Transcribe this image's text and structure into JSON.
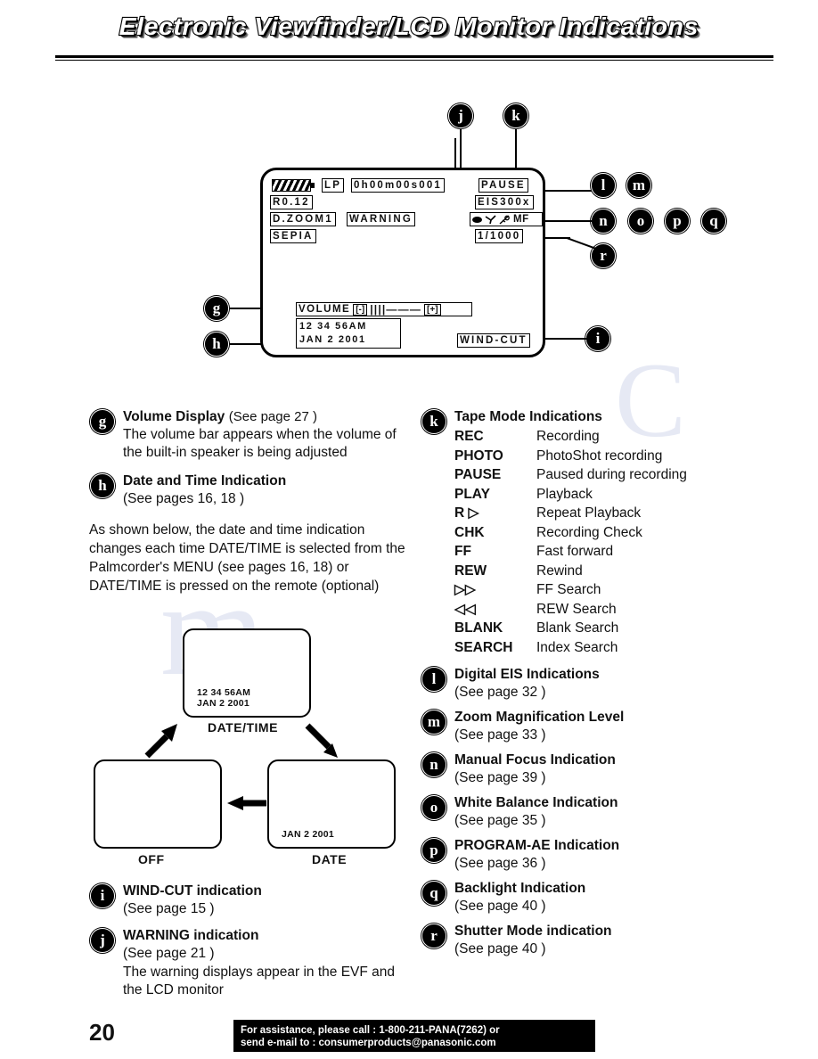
{
  "page": {
    "title": "Electronic Viewfinder/LCD Monitor Indications",
    "number": "20"
  },
  "lcd": {
    "battery_icon": "battery-icon",
    "tape_speed": "LP",
    "counter": "0h00m00s001",
    "tape_mode": "PAUSE",
    "remaining": "R0.12",
    "eis_zoom": "EIS300x",
    "digital_zoom": "D.ZOOM1",
    "warning": "WARNING",
    "focus": "MF",
    "effect": "SEPIA",
    "shutter": "1/1000",
    "volume_label": "VOLUME",
    "volume_minus": "[-]",
    "volume_ticks": "||||———",
    "volume_plus": "[+]",
    "time": "12 34 56AM",
    "date": "JAN  2 2001",
    "wind_cut": "WIND-CUT"
  },
  "callouts": {
    "g": "g",
    "h": "h",
    "i": "i",
    "j": "j",
    "k": "k",
    "l": "l",
    "m": "m",
    "n": "n",
    "o": "o",
    "p": "p",
    "q": "q",
    "r": "r"
  },
  "left_column": {
    "volume": {
      "badge": "g",
      "title": "Volume Display",
      "ref": "(See page 27 )",
      "body": "The volume bar appears when the volume of the built-in speaker is being adjusted"
    },
    "datetime": {
      "badge": "h",
      "title": "Date and Time Indication",
      "ref": "(See pages 16, 18 )"
    },
    "datetime_paragraph": "As shown below, the date and time indication changes each time DATE/TIME is selected from the Palmcorder's MENU (see pages 16, 18) or DATE/TIME is pressed on the remote (optional)",
    "windcut": {
      "badge": "i",
      "title": "WIND-CUT indication",
      "ref": "(See page 15 )"
    },
    "warning": {
      "badge": "j",
      "title": "WARNING indication",
      "ref": "(See page 21 )",
      "body": "The warning displays appear in the EVF and the LCD monitor"
    }
  },
  "flow_diagram": {
    "screens": [
      {
        "id": "datetime",
        "caption": "DATE/TIME",
        "line1": "12 34 56AM",
        "line2": "JAN 2 2001"
      },
      {
        "id": "date",
        "caption": "DATE",
        "line1": "JAN 2 2001",
        "line2": ""
      },
      {
        "id": "off",
        "caption": "OFF",
        "line1": "",
        "line2": ""
      }
    ]
  },
  "right_column": {
    "tape_mode": {
      "badge": "k",
      "title": "Tape Mode Indications",
      "rows": [
        {
          "code": "REC",
          "desc": "Recording"
        },
        {
          "code": "PHOTO",
          "desc": "PhotoShot recording"
        },
        {
          "code": "PAUSE",
          "desc": "Paused during recording"
        },
        {
          "code": "PLAY",
          "desc": "Playback"
        },
        {
          "code": "R ▷",
          "desc": "Repeat Playback"
        },
        {
          "code": "CHK",
          "desc": "Recording Check"
        },
        {
          "code": "FF",
          "desc": "Fast forward"
        },
        {
          "code": "REW",
          "desc": "Rewind"
        },
        {
          "code": "▷▷",
          "desc": "FF Search"
        },
        {
          "code": "◁◁",
          "desc": "REW Search"
        },
        {
          "code": "BLANK",
          "desc": "Blank Search"
        },
        {
          "code": "SEARCH",
          "desc": "Index Search"
        }
      ]
    },
    "items": [
      {
        "badge": "l",
        "title": "Digital EIS Indications",
        "ref": "(See page 32 )"
      },
      {
        "badge": "m",
        "title": "Zoom Magnification Level",
        "ref": "(See page 33 )"
      },
      {
        "badge": "n",
        "title": "Manual Focus Indication",
        "ref": "(See page 39 )"
      },
      {
        "badge": "o",
        "title": "White Balance Indication",
        "ref": "(See page 35 )"
      },
      {
        "badge": "p",
        "title": "PROGRAM-AE Indication",
        "ref": "(See page 36 )"
      },
      {
        "badge": "q",
        "title": "Backlight Indication",
        "ref": "(See page 40 )"
      },
      {
        "badge": "r",
        "title": "Shutter Mode indication",
        "ref": "(See page 40 )"
      }
    ]
  },
  "footer": {
    "line1": "For assistance, please call : 1-800-211-PANA(7262) or",
    "line2": "send e-mail to : consumerproducts@panasonic.com"
  }
}
